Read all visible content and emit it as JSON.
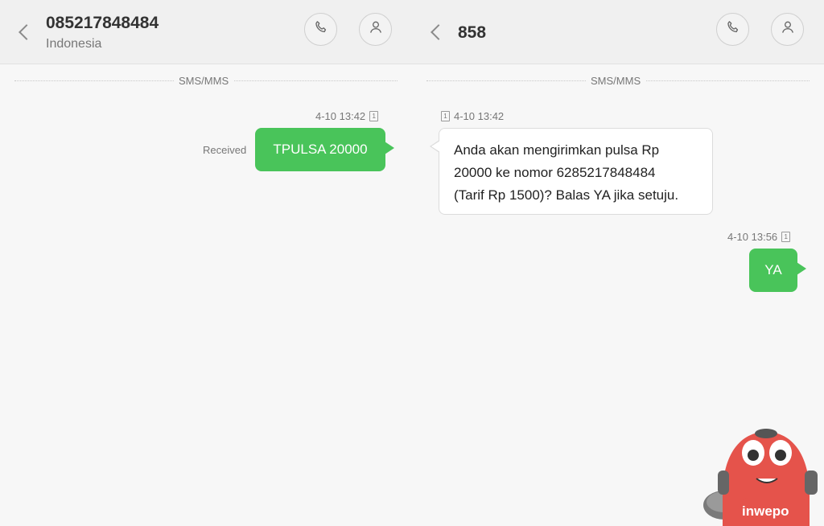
{
  "left": {
    "header": {
      "title": "085217848484",
      "subtitle": "Indonesia",
      "call_icon": "phone-icon",
      "contact_icon": "person-icon"
    },
    "divider_label": "SMS/MMS",
    "messages": [
      {
        "direction": "outgoing",
        "time": "4-10 13:42",
        "sim": "1",
        "status": "Received",
        "text": "TPULSA 20000"
      }
    ]
  },
  "right": {
    "header": {
      "title": "858",
      "call_icon": "phone-icon",
      "contact_icon": "person-icon"
    },
    "divider_label": "SMS/MMS",
    "messages": [
      {
        "direction": "incoming",
        "time": "4-10 13:42",
        "sim": "1",
        "lines": [
          "Anda akan mengirimkan pulsa Rp",
          "20000 ke nomor 6285217848484",
          "(Tarif Rp 1500)? Balas YA jika setuju."
        ]
      },
      {
        "direction": "outgoing",
        "time": "4-10 13:56",
        "sim": "1",
        "text": "YA"
      }
    ]
  },
  "watermark": {
    "text": "inwepo"
  },
  "colors": {
    "outgoing_bubble": "#49c45a",
    "incoming_bubble": "#ffffff",
    "header_bg": "#f0f0f0",
    "mascot": "#e5534b"
  }
}
